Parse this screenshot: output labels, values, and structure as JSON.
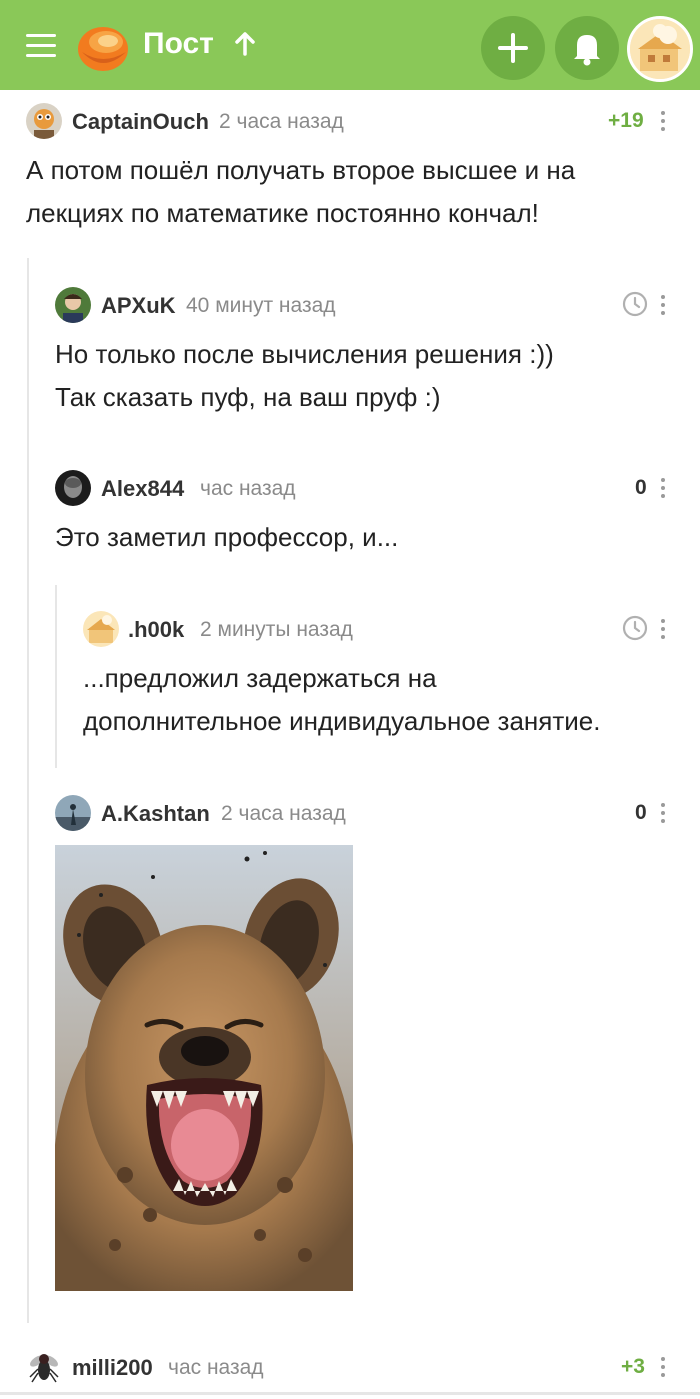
{
  "header": {
    "title": "Пост",
    "brand_color": "#8ac858",
    "icons": [
      "menu-icon",
      "pikabu-logo-icon",
      "arrow-up-icon",
      "plus-icon",
      "bell-icon",
      "user-avatar-icon"
    ]
  },
  "comments": [
    {
      "author": "CaptainOuch",
      "time": "2 часа назад",
      "rating": "+19",
      "text_lines": [
        "А потом пошёл получать второе высшее и на",
        "лекциях по математике постоянно кончал!"
      ]
    },
    {
      "author": "APXuK",
      "time": "40 минут назад",
      "rating_icon": "clock-icon",
      "text_lines": [
        "Но только после вычисления решения :))",
        "Так сказать пуф, на ваш пруф :)"
      ]
    },
    {
      "author": "Alex844",
      "time": "час назад",
      "rating": "0",
      "text_lines": [
        "Это заметил профессор, и..."
      ]
    },
    {
      "author": ".h00k",
      "time": "2 минуты назад",
      "rating_icon": "clock-icon",
      "text_lines": [
        "...предложил задержаться на",
        "дополнительное индивидуальное занятие."
      ]
    },
    {
      "author": "A.Kashtan",
      "time": "2 часа назад",
      "rating": "0",
      "image": "laughing-hyena-photo"
    },
    {
      "author": "milli200",
      "time": "час назад",
      "rating": "+3"
    }
  ]
}
